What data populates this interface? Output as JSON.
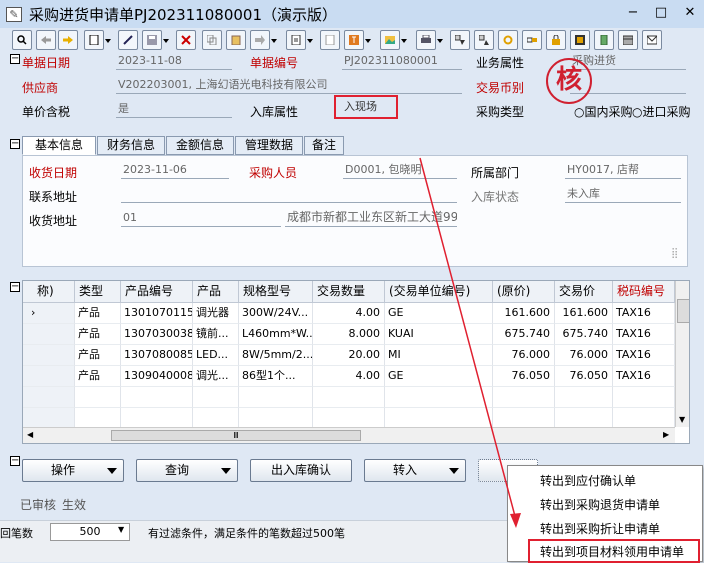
{
  "window": {
    "title": "采购进货申请单PJ202311080001（演示版）",
    "minimize": "−",
    "maximize": "□",
    "close": "✕"
  },
  "header": {
    "doc_date_label": "单据日期",
    "doc_date": "2023-11-08",
    "doc_no_label": "单据编号",
    "doc_no": "PJ202311080001",
    "biz_attr_label": "业务属性",
    "biz_attr": "采购进货",
    "supplier_label": "供应商",
    "supplier": "V202203001, 上海幻语光电科技有限公司",
    "currency_label": "交易币别",
    "currency": "",
    "tax_incl_label": "单价含税",
    "tax_incl": "是",
    "stock_attr_label": "入库属性",
    "stock_attr": "入现场",
    "purchase_type_label": "采购类型",
    "domestic": "国内采购",
    "import": "进口采购",
    "stamp": "核"
  },
  "tabs": [
    "基本信息",
    "财务信息",
    "金额信息",
    "管理数据",
    "备注"
  ],
  "basic": {
    "receive_date_label": "收货日期",
    "receive_date": "2023-11-06",
    "buyer_label": "采购人员",
    "buyer": "D0001, 包晓明",
    "dept_label": "所属部门",
    "dept": "HY0017, 店帮",
    "contact_addr_label": "联系地址",
    "contact_addr": "",
    "stock_status_label": "入库状态",
    "stock_status": "未入库",
    "receive_addr_label": "收货地址",
    "receive_addr_code": "01",
    "receive_addr": "成都市新都工业东区新工大道99"
  },
  "grid": {
    "headers": [
      "称)",
      "类型",
      "产品编号",
      "产品",
      "规格型号",
      "交易数量",
      "(交易单位编号)",
      "(原价)",
      "交易价",
      "税码编号"
    ],
    "rows": [
      {
        "type": "产品",
        "code": "1301070115",
        "name": "调光器",
        "spec": "300W/24V...",
        "qty": "4.00",
        "unit": "GE",
        "orig": "161.600",
        "price": "161.600",
        "tax": "TAX16"
      },
      {
        "type": "产品",
        "code": "1307030038",
        "name": "镜前...",
        "spec": "L460mm*W...",
        "qty": "8.000",
        "unit": "KUAI",
        "orig": "675.740",
        "price": "675.740",
        "tax": "TAX16"
      },
      {
        "type": "产品",
        "code": "1307080085",
        "name": "LED...",
        "spec": "8W/5mm/2...",
        "qty": "20.00",
        "unit": "MI",
        "orig": "76.000",
        "price": "76.000",
        "tax": "TAX16"
      },
      {
        "type": "产品",
        "code": "1309040008",
        "name": "调光...",
        "spec": "86型1个...",
        "qty": "4.00",
        "unit": "GE",
        "orig": "76.050",
        "price": "76.050",
        "tax": "TAX16"
      }
    ],
    "hscroll_thumb": "Ⅲ"
  },
  "actions": {
    "operate": "操作",
    "query": "查询",
    "io_confirm": "出入库确认",
    "transfer_in": "转入"
  },
  "menu": [
    "转出到应付确认单",
    "转出到采购退货申请单",
    "转出到采购折让申请单",
    "转出到项目材料领用申请单"
  ],
  "status": {
    "audited": "已审核",
    "effective": "生效"
  },
  "bottom": {
    "left_label": "回笔数",
    "count": "500",
    "note": "有过滤条件，满足条件的笔数超过500笔"
  },
  "colors": {
    "accent_red": "#e02030",
    "label_red": "#c00000",
    "title_bg": "#c9dcf2"
  }
}
